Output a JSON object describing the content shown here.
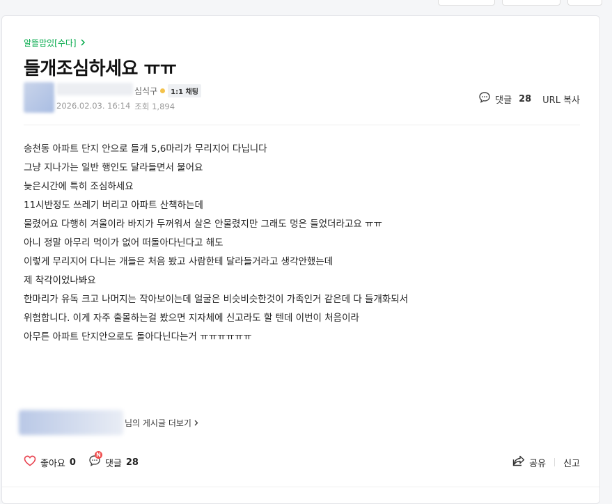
{
  "article": {
    "category": "알뜰맘있[수다]",
    "title": "들개조심하세요 ㅠㅠ",
    "author": {
      "rank": "심식구",
      "chat_badge": "1:1 채팅",
      "date": "2026.02.03. 16:14",
      "views": "조회 1,894"
    },
    "actions": {
      "comment_label": "댓글",
      "comment_count": "28",
      "url_copy": "URL 복사"
    },
    "body": [
      "송천동 아파트 단지 안으로 들개 5,6마리가 무리지어 다닙니다",
      "그냥 지나가는 일반 행인도 달라들면서 물어요",
      "늦은시간에 특히 조심하세요",
      "11시반정도 쓰레기 버리고 아파트 산책하는데",
      "물렸어요 다행히 겨울이라 바지가 두꺼워서 살은 안물렸지만 그래도 멍은 들었더라고요 ㅠㅠ",
      "아니 정말 아무리 먹이가 없어 떠돌아다닌다고 해도",
      "이렇게 무리지어 다니는 개들은 처음 봤고 사람한테 달라들거라고 생각안했는데",
      "제 착각이었나봐요",
      "한마리가 유독 크고 나머지는 작아보이는데 얼굴은 비슷비슷한것이 가족인거 같은데 다 들개화되서",
      "위험합니다. 이게 자주 출몰하는걸 봤으면 지자체에 신고라도 할 텐데 이번이 처음이라",
      "아무튼 아파트 단지안으로도 돌아다닌다는거 ㅠㅠㅠㅠㅠㅠ"
    ],
    "author_more": "님의 게시글 더보기",
    "footer": {
      "like_label": "좋아요",
      "like_count": "0",
      "comment_label": "댓글",
      "comment_count": "28",
      "comment_badge": "N",
      "share": "공유",
      "report": "신고"
    }
  },
  "colors": {
    "accent": "#03a94a",
    "like_heart": "#e8424f",
    "badge": "#f04d4d"
  },
  "icons": [
    "chevron-right-icon",
    "speech-bubble-icon",
    "heart-icon",
    "share-icon"
  ]
}
